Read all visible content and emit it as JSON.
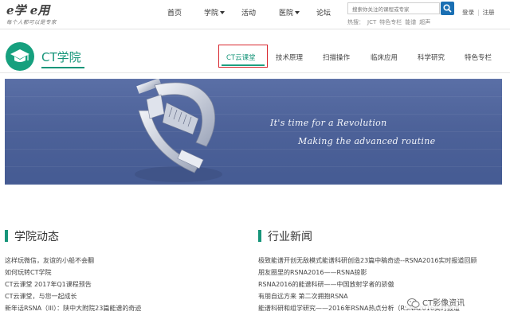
{
  "site": {
    "logo_text": "e学 e用",
    "logo_tagline": "每个人都可以是专家"
  },
  "nav": {
    "items": [
      {
        "label": "首页",
        "has_dropdown": false
      },
      {
        "label": "学院",
        "has_dropdown": true
      },
      {
        "label": "活动",
        "has_dropdown": false
      },
      {
        "label": "医院",
        "has_dropdown": true
      },
      {
        "label": "论坛",
        "has_dropdown": false
      }
    ]
  },
  "search": {
    "placeholder": "搜索你关注的课程或专家",
    "hot_label": "热搜：",
    "hot_terms": [
      "JCT",
      "特色专栏",
      "能谱",
      "超声"
    ]
  },
  "auth": {
    "login": "登录",
    "separator": "|",
    "register": "注册"
  },
  "section": {
    "title": "CT学院",
    "tabs": [
      {
        "label": "CT云课堂",
        "active": true
      },
      {
        "label": "技术原理",
        "active": false
      },
      {
        "label": "扫描操作",
        "active": false
      },
      {
        "label": "临床应用",
        "active": false
      },
      {
        "label": "科学研究",
        "active": false
      },
      {
        "label": "特色专栏",
        "active": false
      }
    ]
  },
  "banner": {
    "line1": "It's time for a Revolution",
    "line2": "Making the advanced routine"
  },
  "news_left": {
    "title": "学院动态",
    "items": [
      "这样玩微信，友谊的小船不会翻",
      "如何玩转CT学院",
      "CT云课堂 2017年Q1课程预告",
      "CT云课堂，与您一起成长",
      "新年话RSNA（III）：陕中大附院23篇能谱的奇迹"
    ]
  },
  "news_right": {
    "title": "行业新闻",
    "items": [
      "极致能谱开创无敌模式能谱科研创造23篇中稿奇迹--RSNA2016实时报道回顾",
      "朋友圈里的RSNA2016——RSNA掠影",
      "RSNA2016的能谱科研——中国放射学者的骄傲",
      "有朋自远方来 第二次拥抱RSNA",
      "能谱科研和组学研究——2016年RSNA热点分析（RSNA2016实时报道"
    ]
  },
  "watermark": {
    "text": "CT影像资讯"
  },
  "colors": {
    "accent": "#17957a",
    "active_outline": "#d8262e",
    "search_button": "#1a6fb3",
    "banner": "#4d6299"
  }
}
